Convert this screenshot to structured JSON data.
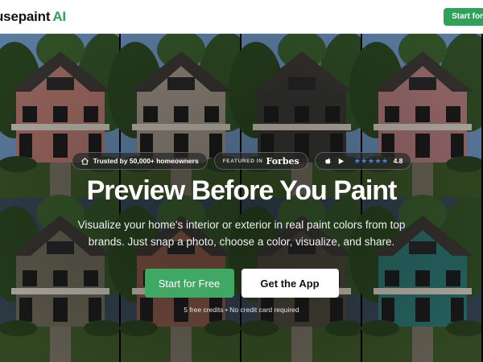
{
  "header": {
    "logo_text": "usepaint",
    "logo_accent": "AI",
    "cta_label": "Start for"
  },
  "hero": {
    "badges": {
      "trusted": "Trusted by 50,000+ homeowners",
      "featured_label": "FEATURED IN",
      "featured_brand": "Forbes",
      "stars": "★★★★★",
      "rating": "4.8"
    },
    "headline": "Preview Before You Paint",
    "subtext": "Visualize your home's interior or exterior in real paint colors from top brands. Just snap a photo, choose a color, visualize, and share.",
    "primary_cta": "Start for Free",
    "secondary_cta": "Get the App",
    "note": "5 free credits • No credit card required",
    "house_colors": [
      "#b87a72",
      "#a59a8c",
      "#3a3a36",
      "#b67e80",
      "#6f6a5a",
      "#8a5a4a",
      "#4e4a3e",
      "#2f7a76"
    ]
  },
  "colors": {
    "brand_green": "#2ea25a",
    "star_blue": "#3b82f6"
  },
  "icons": [
    "house-icon",
    "apple-icon",
    "play-store-icon"
  ]
}
